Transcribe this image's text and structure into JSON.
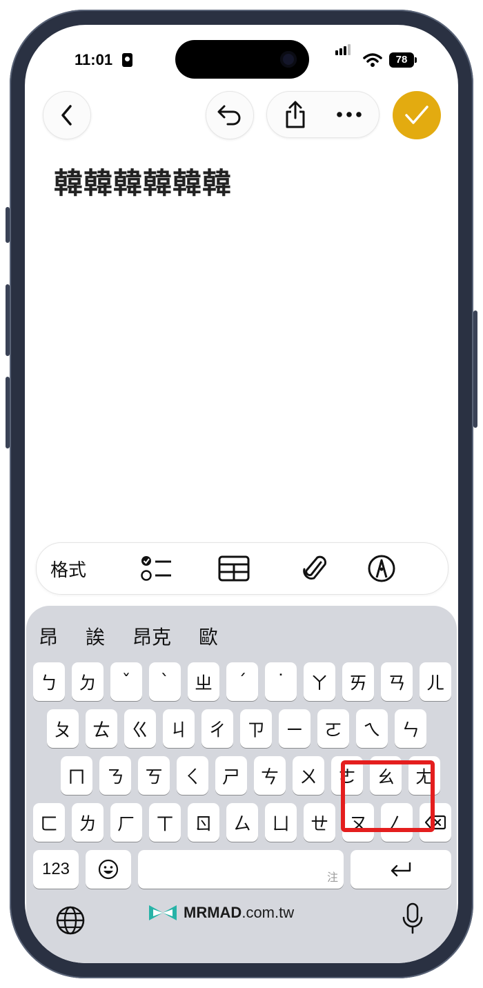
{
  "status_bar": {
    "time": "11:01",
    "battery": "78"
  },
  "note": {
    "text": "韓韓韓韓韓韓"
  },
  "toolbar": {
    "format_label": "格式"
  },
  "candidates": [
    "昂",
    "誒",
    "昂克",
    "歐"
  ],
  "keyboard": {
    "row1": [
      "ㄅ",
      "ㄉ",
      "ˇ",
      "ˋ",
      "ㄓ",
      "ˊ",
      "˙",
      "ㄚ",
      "ㄞ",
      "ㄢ",
      "ㄦ"
    ],
    "row2": [
      "ㄆ",
      "ㄊ",
      "ㄍ",
      "ㄐ",
      "ㄔ",
      "ㄗ",
      "ㄧ",
      "ㄛ",
      "ㄟ",
      "ㄣ"
    ],
    "row3": [
      "ㄇ",
      "ㄋ",
      "ㄎ",
      "ㄑ",
      "ㄕ",
      "ㄘ",
      "ㄨ",
      "ㄜ",
      "ㄠ",
      "ㄤ"
    ],
    "row4": [
      "ㄈ",
      "ㄌ",
      "ㄏ",
      "ㄒ",
      "ㄖ",
      "ㄙ",
      "ㄩ",
      "ㄝ",
      "ㄡ",
      "ㄥ"
    ],
    "numbers_label": "123",
    "space_hint": "注",
    "delete_icon": "delete-backward-icon",
    "return_icon": "return-arrow-icon"
  },
  "watermark": {
    "brand": "MRMAD",
    "domain": ".com.tw"
  },
  "colors": {
    "done_button": "#e3ab10",
    "highlight": "#e41e1e",
    "keyboard_bg": "#d5d7dd"
  }
}
